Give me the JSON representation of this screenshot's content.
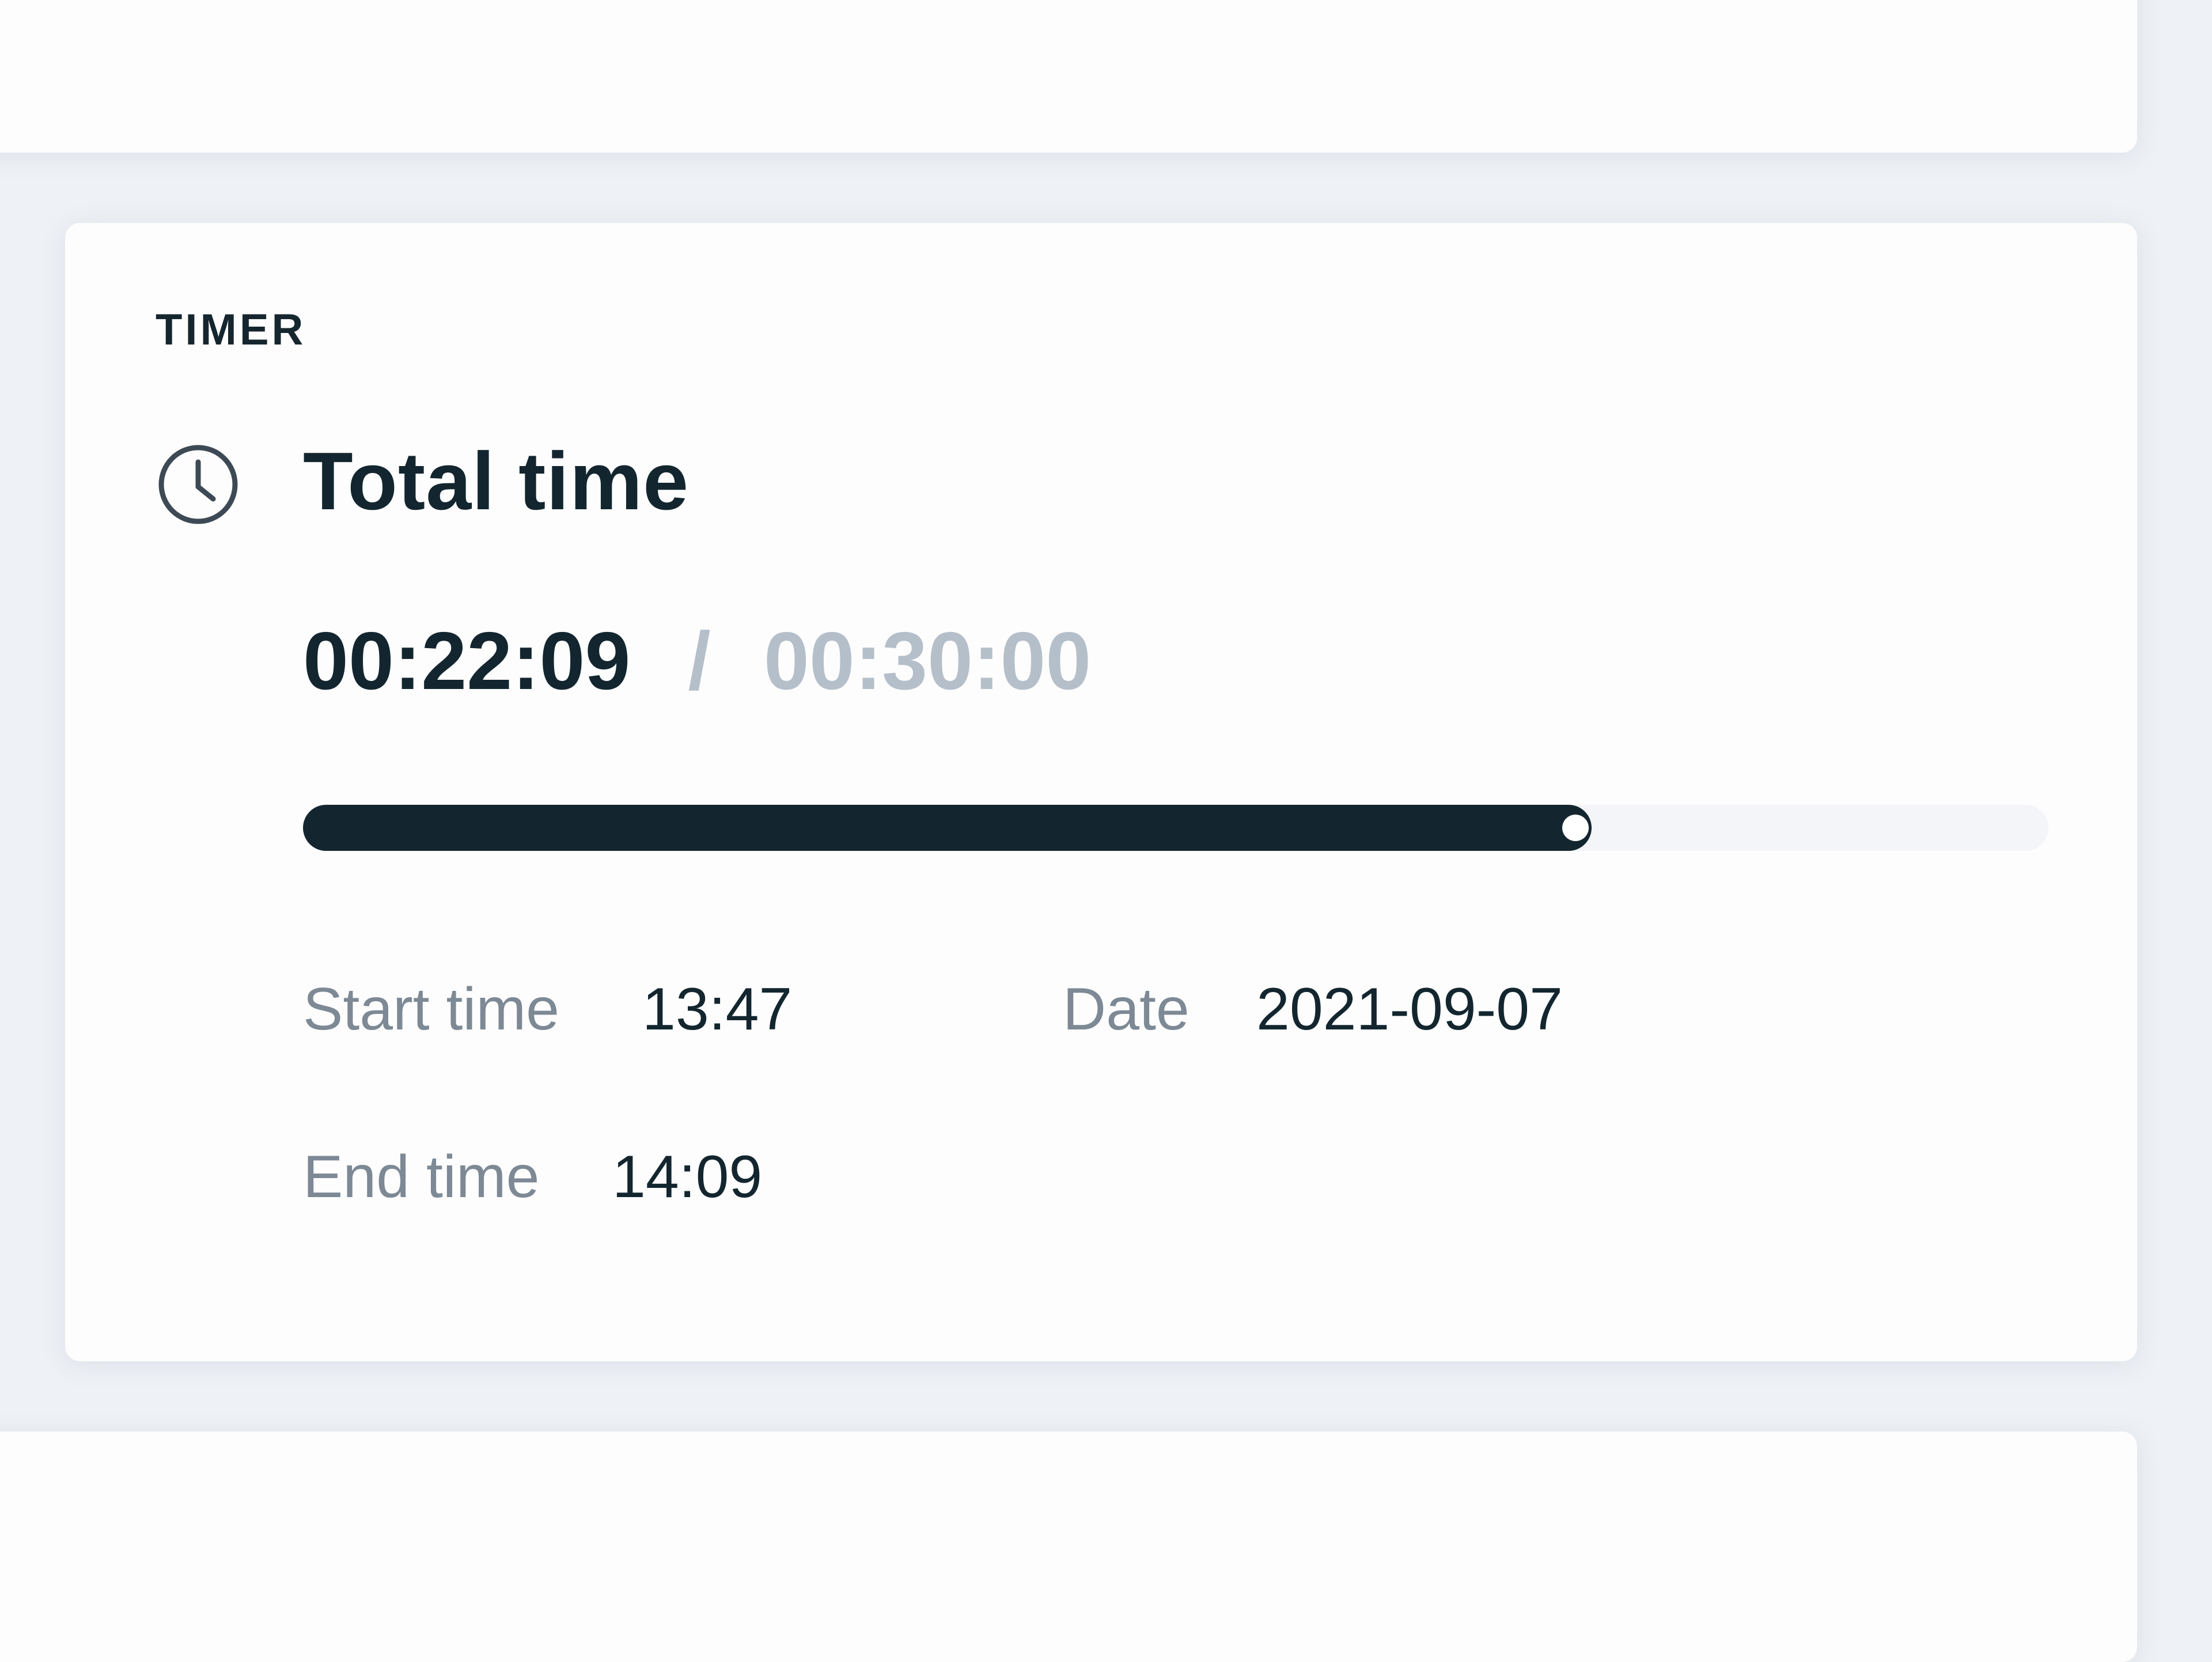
{
  "timer_card": {
    "section_label": "TIMER",
    "title": "Total time",
    "icon": "clock-icon",
    "elapsed": "00:22:09",
    "separator": "/",
    "total": "00:30:00",
    "progress_fraction": 0.7383,
    "start_time_label": "Start time",
    "start_time_value": "13:47",
    "date_label": "Date",
    "date_value": "2021-09-07",
    "end_time_label": "End time",
    "end_time_value": "14:09"
  },
  "colors": {
    "background": "#eef1f5",
    "card": "#fdfdfd",
    "primary_text": "#13262f",
    "muted_text": "#7d8995",
    "faded_value": "#b5bfca",
    "progress_track": "#f4f5f8",
    "progress_fill": "#13262f"
  }
}
